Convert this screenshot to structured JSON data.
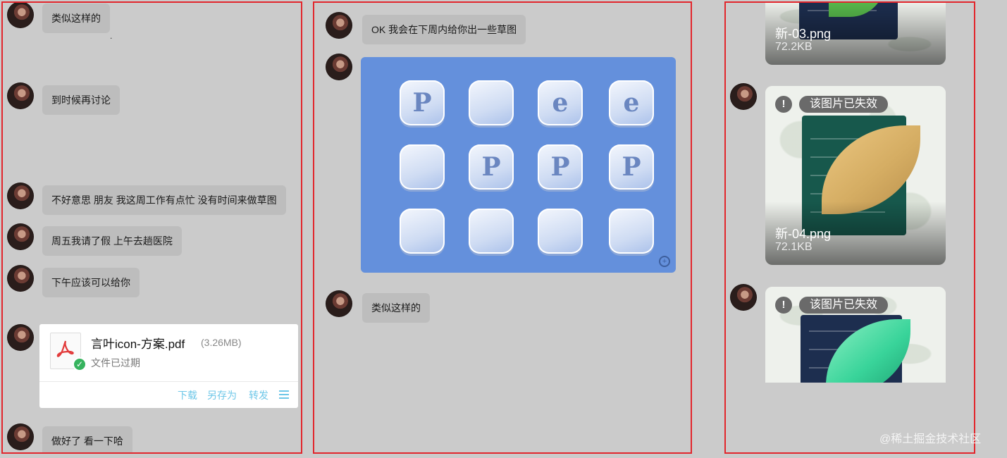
{
  "left": {
    "messages": [
      "类似这样的",
      "到时候再讨论",
      "不好意思 朋友 我这周工作有点忙 没有时间来做草图",
      "周五我请了假 上午去趟医院",
      "下午应该可以给你",
      "做好了 看一下哈"
    ],
    "dot": ".",
    "file": {
      "name": "言叶icon-方案.pdf",
      "size": "(3.26MB)",
      "status": "文件已过期",
      "actions": [
        "下载",
        "另存为",
        "转发"
      ]
    }
  },
  "middle": {
    "messages": [
      "OK 我会在下周内给你出一些草图",
      "类似这样的"
    ],
    "icons": [
      "P",
      "",
      "e",
      "e",
      "",
      "P",
      "P",
      "P",
      "",
      "",
      "",
      ""
    ]
  },
  "right": {
    "images": [
      {
        "name": "新-03.png",
        "size": "72.2KB",
        "invalid": ""
      },
      {
        "name": "新-04.png",
        "size": "72.1KB",
        "invalid": "该图片已失效"
      },
      {
        "name": "",
        "size": "",
        "invalid": "该图片已失效"
      }
    ]
  },
  "watermark": "@稀土掘金技术社区",
  "colors": {
    "border": "#e2262c",
    "bubble": "#bdbdbd",
    "link": "#6ec7e8",
    "background": "#cbcbcb"
  }
}
